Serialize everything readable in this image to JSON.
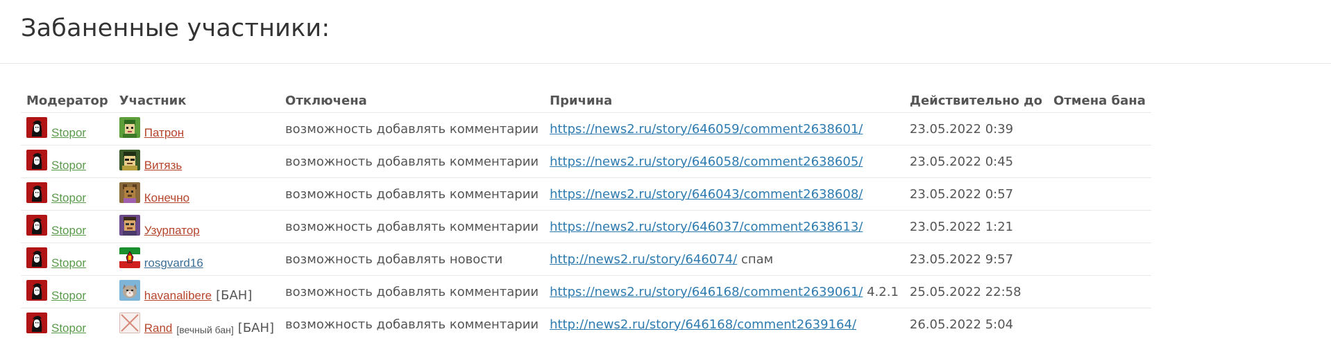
{
  "page": {
    "title": "Забаненные участники:"
  },
  "table": {
    "headers": {
      "moderator": "Модератор",
      "member": "Участник",
      "disabled": "Отключена",
      "reason": "Причина",
      "valid_until": "Действительно до",
      "unban": "Отмена бана"
    },
    "rows": [
      {
        "moderator": "Stopor",
        "member": "Патрон",
        "member_note": "",
        "member_ban": "",
        "disabled": "возможность добавлять комментарии",
        "reason_link": "https://news2.ru/story/646059/comment2638601/",
        "reason_text": "",
        "valid_until": "23.05.2022 0:39",
        "unban": ""
      },
      {
        "moderator": "Stopor",
        "member": "Витязь",
        "member_note": "",
        "member_ban": "",
        "disabled": "возможность добавлять комментарии",
        "reason_link": "https://news2.ru/story/646058/comment2638605/",
        "reason_text": "",
        "valid_until": "23.05.2022 0:45",
        "unban": ""
      },
      {
        "moderator": "Stopor",
        "member": "Конечно",
        "member_note": "",
        "member_ban": "",
        "disabled": "возможность добавлять комментарии",
        "reason_link": "https://news2.ru/story/646043/comment2638608/",
        "reason_text": "",
        "valid_until": "23.05.2022 0:57",
        "unban": ""
      },
      {
        "moderator": "Stopor",
        "member": "Узурпатор",
        "member_note": "",
        "member_ban": "",
        "disabled": "возможность добавлять комментарии",
        "reason_link": "https://news2.ru/story/646037/comment2638613/",
        "reason_text": "",
        "valid_until": "23.05.2022 1:21",
        "unban": ""
      },
      {
        "moderator": "Stopor",
        "member": "rosgvard16",
        "member_note": "",
        "member_ban": "",
        "disabled": "возможность добавлять новости",
        "reason_link": "http://news2.ru/story/646074/",
        "reason_text": "спам",
        "valid_until": "23.05.2022 9:57",
        "unban": ""
      },
      {
        "moderator": "Stopor",
        "member": "havanalibere",
        "member_note": "",
        "member_ban": "[БАН]",
        "disabled": "возможность добавлять комментарии",
        "reason_link": "https://news2.ru/story/646168/comment2639061/",
        "reason_text": "4.2.1",
        "valid_until": "25.05.2022 22:58",
        "unban": ""
      },
      {
        "moderator": "Stopor",
        "member": "Rand",
        "member_note": "[вечный бан]",
        "member_ban": "[БАН]",
        "disabled": "возможность добавлять комментарии",
        "reason_link": "http://news2.ru/story/646168/comment2639164/",
        "reason_text": "",
        "valid_until": "26.05.2022 5:04",
        "unban": ""
      }
    ]
  },
  "icons": {
    "moderator_avatar": "che-portrait-icon",
    "avatars": [
      "patron-avatar-icon",
      "vityaz-avatar-icon",
      "konechno-avatar-icon",
      "uzurpator-avatar-icon",
      "tatarstan-flag-avatar-icon",
      "cat-avatar-icon",
      "no-avatar-icon"
    ]
  },
  "colors": {
    "moderator_link": "#5a9a4b",
    "member_link": "#b5452c",
    "member_link_alt": "#3d6f95",
    "reason_link": "#2e7bb0"
  }
}
